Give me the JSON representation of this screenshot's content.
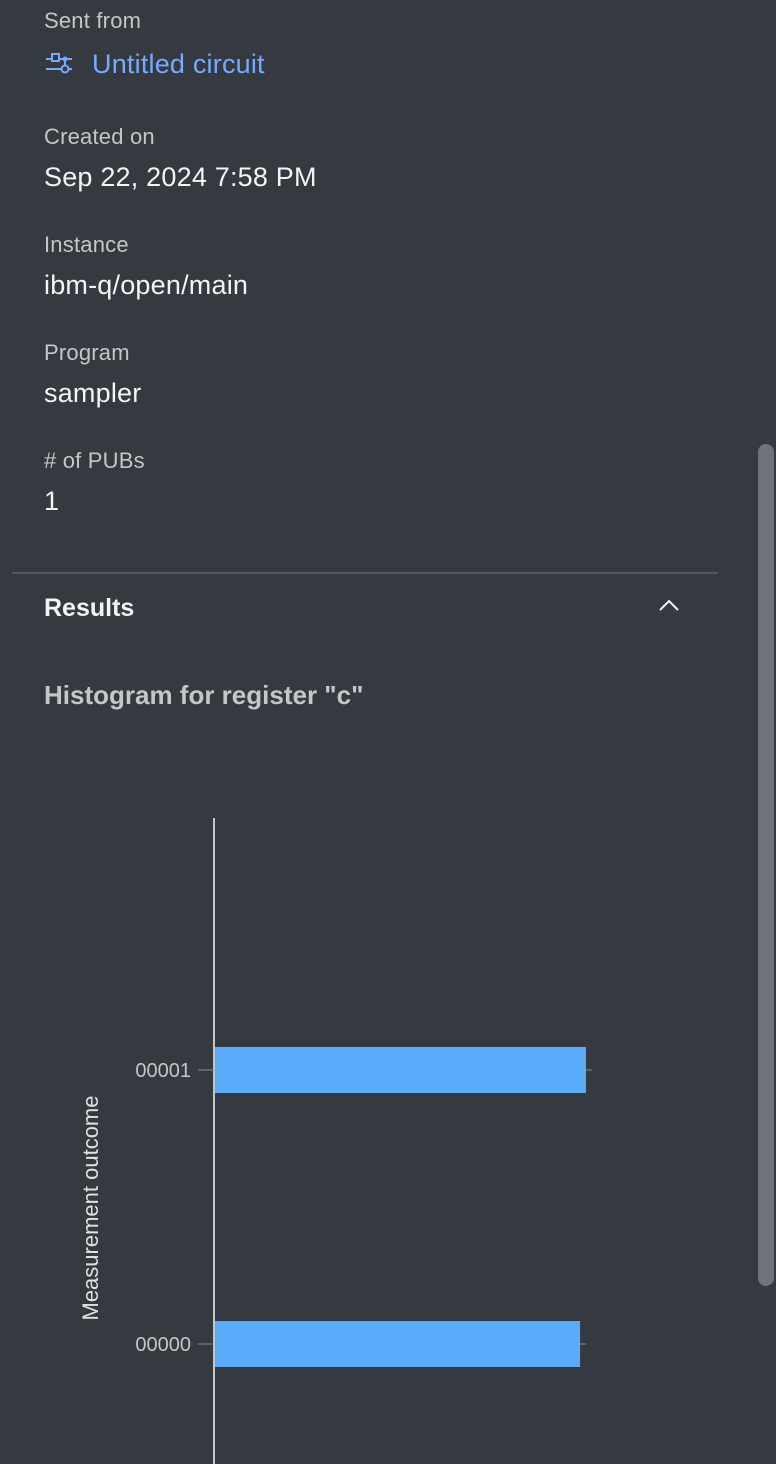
{
  "details": {
    "sent_from_label": "Sent from",
    "sent_from_value": "Untitled circuit",
    "created_on_label": "Created on",
    "created_on_value": "Sep 22, 2024 7:58 PM",
    "instance_label": "Instance",
    "instance_value": "ibm-q/open/main",
    "program_label": "Program",
    "program_value": "sampler",
    "pubs_label": "# of PUBs",
    "pubs_value": "1"
  },
  "results": {
    "title": "Results",
    "expanded": true,
    "chevron_icon": "chevron-up-icon"
  },
  "colors": {
    "background": "#343a3f",
    "link": "#78a9ff",
    "bar": "#5aacfa"
  },
  "chart_data": {
    "type": "bar",
    "orientation": "horizontal",
    "title": "Histogram for register \"c\"",
    "ylabel": "Measurement outcome",
    "xlabel": "",
    "categories": [
      "00001",
      "00000"
    ],
    "values": [
      0.504,
      0.496
    ],
    "grid": false
  }
}
